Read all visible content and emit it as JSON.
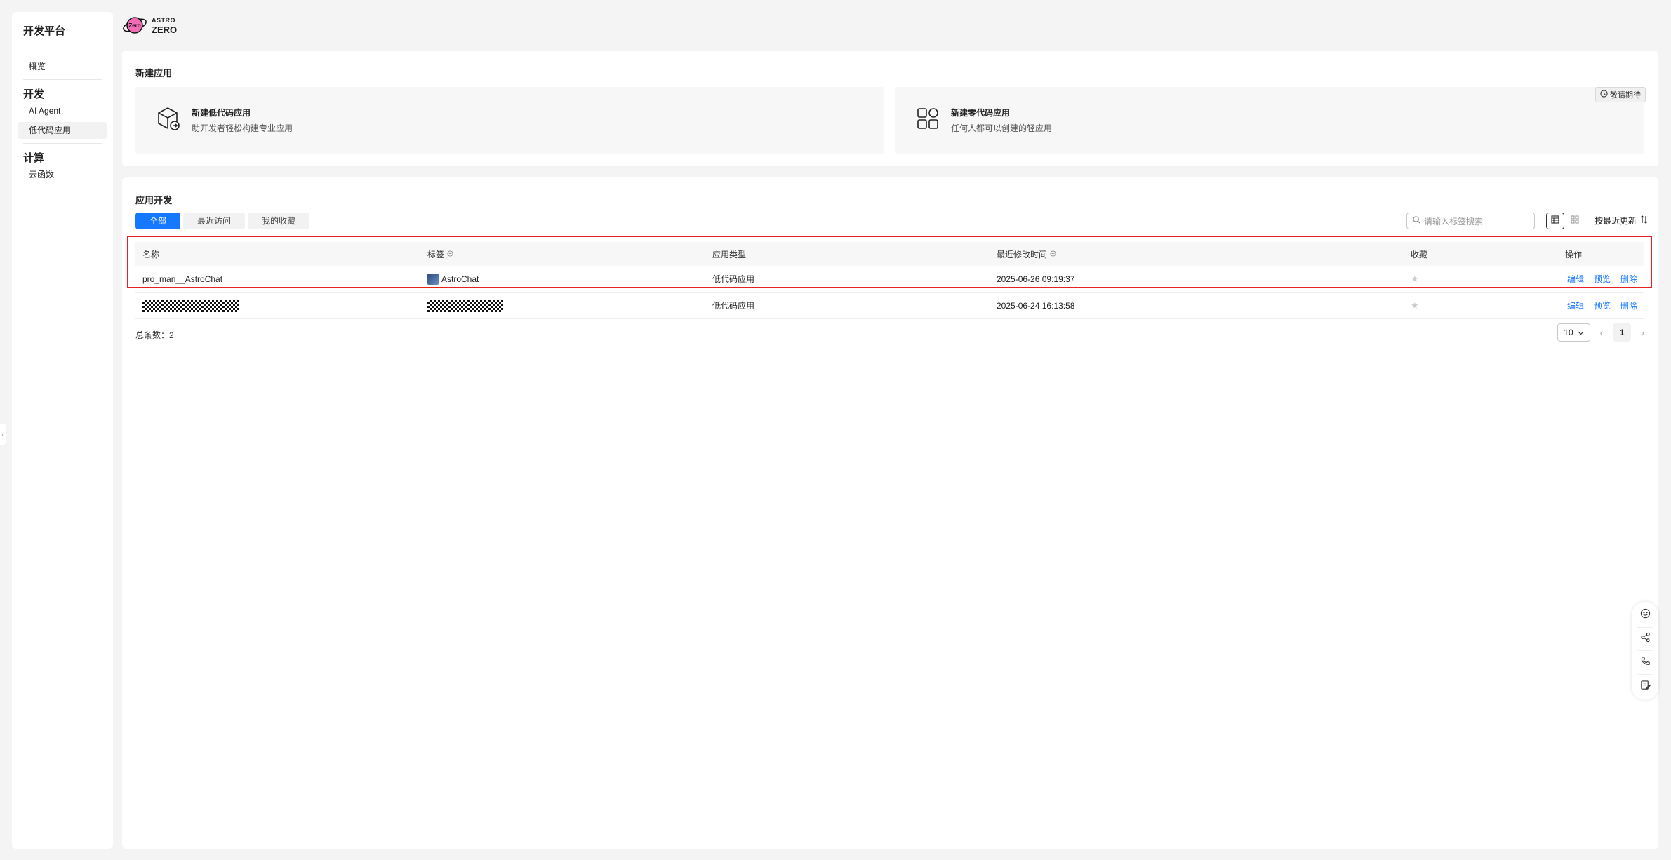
{
  "sidebar": {
    "title": "开发平台",
    "overview": "概览",
    "section_dev": "开发",
    "ai_agent": "AI Agent",
    "lowcode": "低代码应用",
    "section_compute": "计算",
    "cloud_func": "云函数"
  },
  "logo": {
    "line1": "ASTRO",
    "line2": "ZERO",
    "badge": "Zero"
  },
  "new_app": {
    "title": "新建应用",
    "tile1": {
      "name": "新建低代码应用",
      "desc": "助开发者轻松构建专业应用",
      "icon": "box-arrow-icon"
    },
    "tile2": {
      "name": "新建零代码应用",
      "desc": "任何人都可以创建的轻应用",
      "icon": "grid-shapes-icon"
    },
    "soon": "敬请期待"
  },
  "dev": {
    "title": "应用开发",
    "tabs": [
      "全部",
      "最近访问",
      "我的收藏"
    ],
    "search_placeholder": "请输入标签搜索",
    "sort_label": "按最近更新",
    "columns": [
      "名称",
      "标签",
      "应用类型",
      "最近修改时间",
      "收藏",
      "操作"
    ],
    "rows": [
      {
        "name": "pro_man__AstroChat",
        "tag": "AstroChat",
        "type": "低代码应用",
        "modified": "2025-06-26 09:19:37"
      },
      {
        "name": "",
        "tag": "",
        "type": "低代码应用",
        "modified": "2025-06-24 16:13:58"
      }
    ],
    "actions": {
      "edit": "编辑",
      "preview": "预览",
      "delete": "删除"
    },
    "total": "总条数：2",
    "page_size": "10",
    "page": "1"
  }
}
